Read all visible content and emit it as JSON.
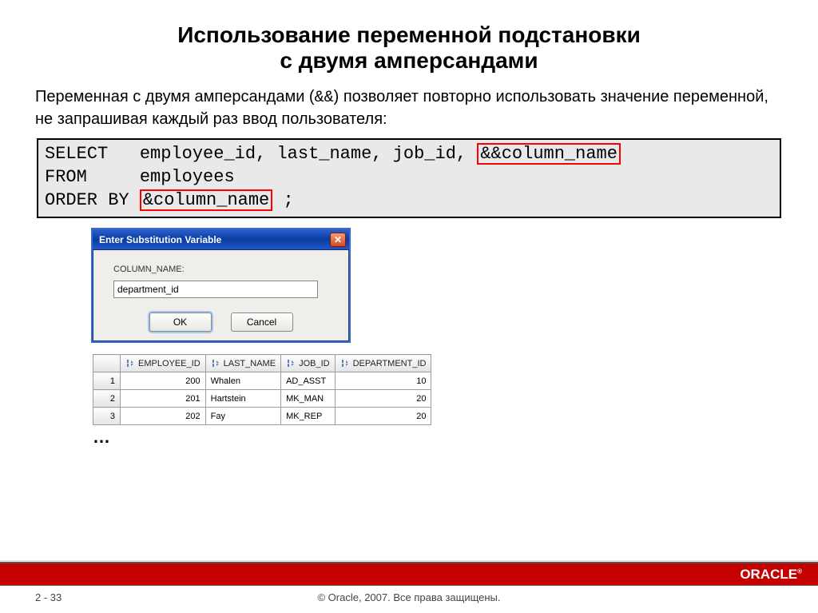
{
  "title_line1": "Использование переменной подстановки",
  "title_line2": "с двумя амперсандами",
  "body_pre": "Переменная с двумя амперсандами (",
  "body_amp": "&&",
  "body_post": ") позволяет повторно использовать значение переменной, не запрашивая каждый раз ввод пользователя:",
  "sql": {
    "select_kw": "SELECT",
    "select_cols": "employee_id, last_name, job_id,",
    "dbl_amp": "&&column_name",
    "from_kw": "FROM",
    "from_val": "employees",
    "order_kw": "ORDER BY",
    "single_amp": "&column_name",
    "semicolon": ";"
  },
  "dialog": {
    "title": "Enter Substitution Variable",
    "label": "COLUMN_NAME:",
    "value": "department_id",
    "ok": "OK",
    "cancel": "Cancel"
  },
  "table": {
    "headers": [
      "EMPLOYEE_ID",
      "LAST_NAME",
      "JOB_ID",
      "DEPARTMENT_ID"
    ],
    "rows": [
      {
        "n": "1",
        "emp": "200",
        "last": "Whalen",
        "job": "AD_ASST",
        "dept": "10"
      },
      {
        "n": "2",
        "emp": "201",
        "last": "Hartstein",
        "job": "MK_MAN",
        "dept": "20"
      },
      {
        "n": "3",
        "emp": "202",
        "last": "Fay",
        "job": "MK_REP",
        "dept": "20"
      }
    ]
  },
  "ellipsis": "…",
  "footer": {
    "page": "2 - 33",
    "copyright": "© Oracle, 2007. Все права защищены.",
    "logo": "ORACLE",
    "reg": "®"
  }
}
